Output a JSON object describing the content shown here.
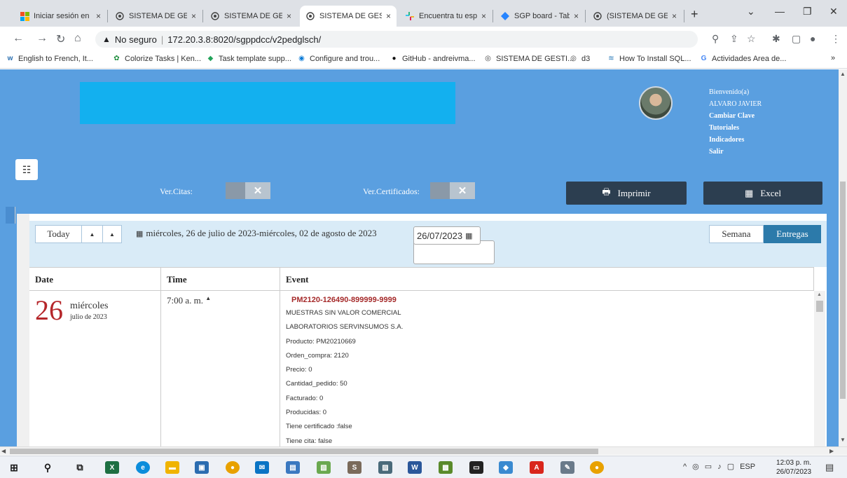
{
  "browser": {
    "tabs": [
      {
        "title": "Iniciar sesión en (",
        "icon": "office-icon"
      },
      {
        "title": "SISTEMA DE GES",
        "icon": "globe-icon"
      },
      {
        "title": "SISTEMA DE GES",
        "icon": "globe-icon"
      },
      {
        "title": "SISTEMA DE GES",
        "icon": "globe-icon",
        "active": true
      },
      {
        "title": "Encuentra tu esp",
        "icon": "slack-icon"
      },
      {
        "title": "SGP board - Tabl",
        "icon": "jira-icon"
      },
      {
        "title": "(SISTEMA DE GES",
        "icon": "globe-icon"
      }
    ],
    "close_glyph": "×",
    "new_tab_glyph": "+",
    "url_warning": "No seguro",
    "url": "172.20.3.8:8020/sgppdcc/v2pedglsch/",
    "bookmarks": [
      "English to French, It...",
      "Colorize Tasks | Ken...",
      "Task template supp...",
      "Configure and trou...",
      "GitHub - andreivma...",
      "SISTEMA DE GESTI...",
      "d3",
      "How To Install SQL...",
      "Actividades Area de..."
    ],
    "bookmarks_more": "»"
  },
  "header": {
    "user_menu": {
      "greeting": "Bienvenido(a)",
      "user_name": "ALVARO JAVIER",
      "change_password": "Cambiar Clave",
      "tutorials": "Tutoriales",
      "indicators": "Indicadores",
      "logout": "Salir"
    }
  },
  "filters": {
    "ver_citas_label": "Ver.Citas:",
    "ver_certificados_label": "Ver.Certificados:",
    "toggle_glyph": "✕"
  },
  "actions": {
    "print_label": "Imprimir",
    "excel_label": "Excel"
  },
  "calendar": {
    "today_label": "Today",
    "prev_glyph": "▲",
    "next_glyph": "▲",
    "range": "miércoles, 26 de julio de 2023-miércoles, 02 de agosto de 2023",
    "date_value": "26/07/2023",
    "views": {
      "week": "Semana",
      "deliveries": "Entregas"
    },
    "active_view": "Entregas",
    "columns": {
      "date": "Date",
      "time": "Time",
      "event": "Event"
    },
    "row": {
      "day_number": "26",
      "day_name": "miércoles",
      "month_year": "julio de 2023",
      "time": "7:00 a. m.",
      "time_marker": "▲",
      "event_code": "PM2120-126490-899999-9999",
      "event_lines": [
        "MUESTRAS SIN VALOR COMERCIAL",
        "LABORATORIOS SERVINSUMOS S.A.",
        "Producto: PM20210669",
        "Orden_compra: 2120",
        "Precio: 0",
        "Cantidad_pedido: 50",
        "Facturado: 0",
        "Producidas: 0",
        "Tiene certificado :false",
        "Tiene cita: false"
      ]
    }
  },
  "taskbar": {
    "language": "ESP",
    "time": "12:03 p. m.",
    "date": "26/07/2023"
  },
  "colors": {
    "page_bg": "#5a9fe0",
    "banner": "#13b0ef",
    "dark_button": "#2c3e50",
    "active_view": "#2c7aaa",
    "day_number": "#b5262a",
    "event_code": "#a52a2a"
  }
}
